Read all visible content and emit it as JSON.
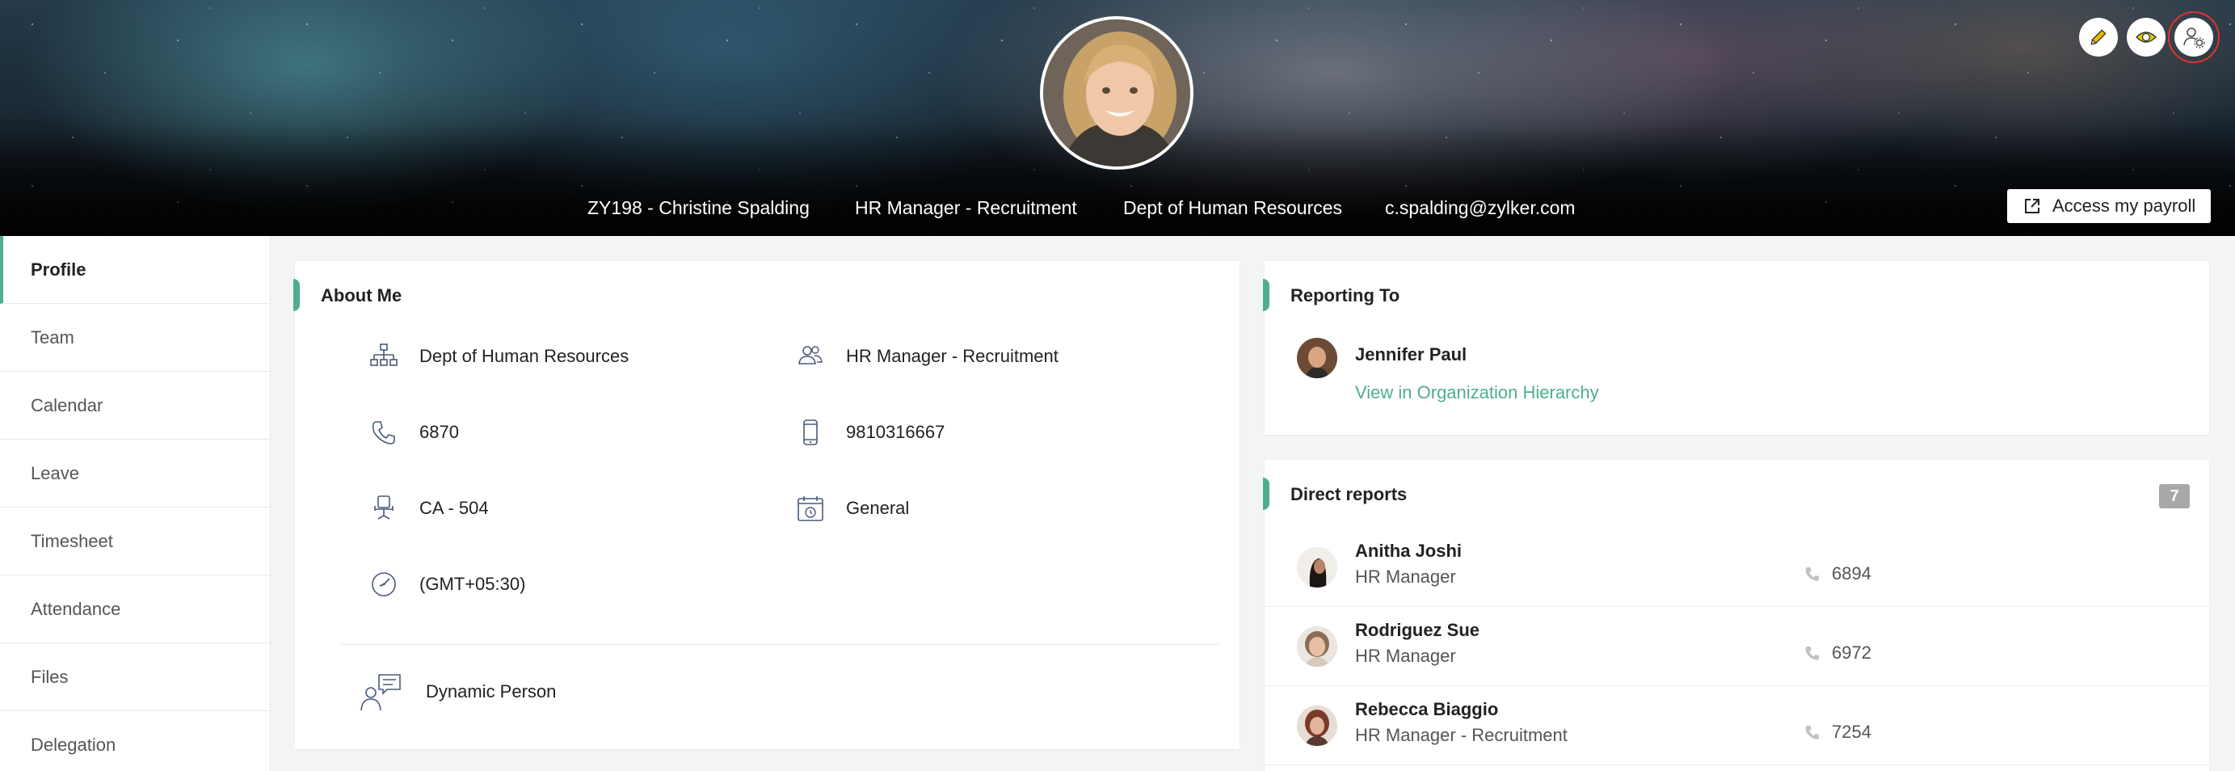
{
  "header": {
    "employee_id_name": "ZY198 - Christine Spalding",
    "designation": "HR Manager - Recruitment",
    "department": "Dept of Human Resources",
    "email": "c.spalding@zylker.com",
    "payroll_button": "Access my payroll",
    "actions": [
      "pencil-icon",
      "eye-icon",
      "user-settings-icon"
    ]
  },
  "sidebar": {
    "items": [
      {
        "label": "Profile",
        "active": true
      },
      {
        "label": "Team"
      },
      {
        "label": "Calendar"
      },
      {
        "label": "Leave"
      },
      {
        "label": "Timesheet"
      },
      {
        "label": "Attendance"
      },
      {
        "label": "Files"
      },
      {
        "label": "Delegation"
      }
    ]
  },
  "about": {
    "title": "About Me",
    "department": "Dept of Human Resources",
    "designation": "HR Manager - Recruitment",
    "extension": "6870",
    "mobile": "9810316667",
    "seat": "CA - 504",
    "shift": "General",
    "timezone": "(GMT+05:30)",
    "persona": "Dynamic Person"
  },
  "reporting": {
    "title": "Reporting To",
    "name": "Jennifer Paul",
    "link": "View in Organization Hierarchy"
  },
  "direct_reports": {
    "title": "Direct reports",
    "count": "7",
    "people": [
      {
        "name": "Anitha Joshi",
        "role": "HR Manager",
        "ext": "6894"
      },
      {
        "name": "Rodriguez Sue",
        "role": "HR Manager",
        "ext": "6972"
      },
      {
        "name": "Rebecca Biaggio",
        "role": "HR Manager - Recruitment",
        "ext": "7254"
      }
    ]
  },
  "colors": {
    "accent": "#4fae8c",
    "highlight": "#e0322e",
    "eye_icon": "#c9a800"
  }
}
